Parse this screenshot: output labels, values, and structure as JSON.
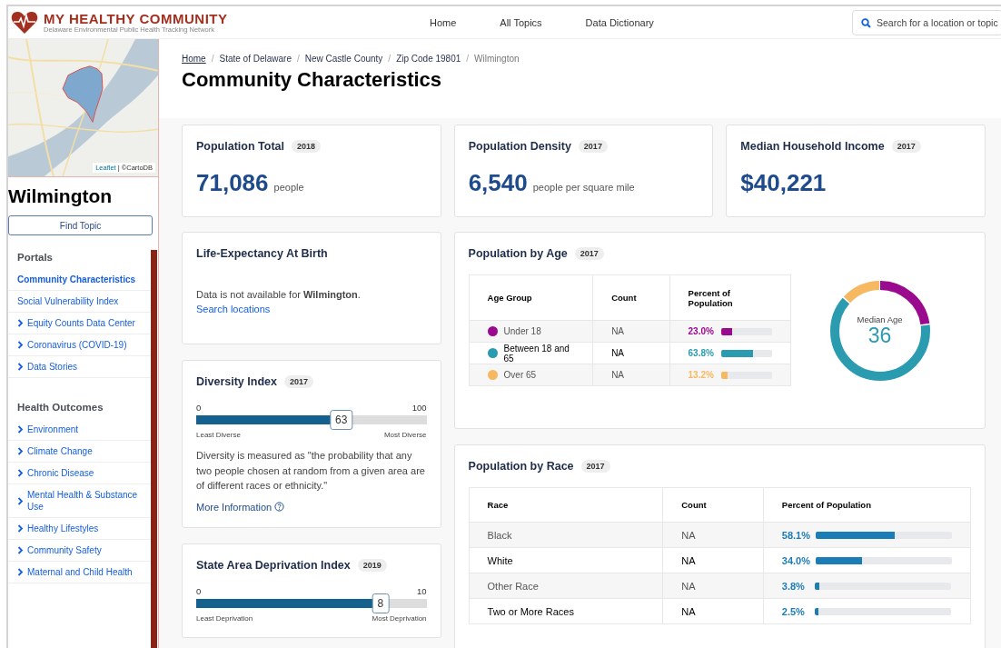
{
  "header": {
    "logo_title": "MY HEALTHY COMMUNITY",
    "logo_subtitle": "Delaware Environmental Public Health Tracking Network",
    "nav": [
      {
        "label": "Home"
      },
      {
        "label": "All Topics"
      },
      {
        "label": "Data Dictionary"
      }
    ],
    "search": {
      "placeholder": "Search for a location or topic"
    }
  },
  "sidebar": {
    "map": {
      "kind": "picture",
      "attribution_link": "Leaflet",
      "attribution": "| ©CartoDB"
    },
    "title": "Wilmington",
    "find_button": "Find Topic",
    "sections": [
      {
        "heading": "Portals",
        "items": [
          {
            "label": "Community Characteristics",
            "selected": true,
            "expandable": false
          },
          {
            "label": "Social Vulnerability Index",
            "selected": false,
            "expandable": false
          },
          {
            "label": "Equity Counts Data Center",
            "selected": false,
            "expandable": true
          },
          {
            "label": "Coronavirus (COVID-19)",
            "selected": false,
            "expandable": true
          },
          {
            "label": "Data Stories",
            "selected": false,
            "expandable": true
          }
        ]
      },
      {
        "heading": "Health Outcomes",
        "items": [
          {
            "label": "Environment",
            "selected": false,
            "expandable": true
          },
          {
            "label": "Climate Change",
            "selected": false,
            "expandable": true
          },
          {
            "label": "Chronic Disease",
            "selected": false,
            "expandable": true
          },
          {
            "label": "Mental Health & Substance Use",
            "selected": false,
            "expandable": true
          },
          {
            "label": "Healthy Lifestyles",
            "selected": false,
            "expandable": true
          },
          {
            "label": "Community Safety",
            "selected": false,
            "expandable": true
          },
          {
            "label": "Maternal and Child Health",
            "selected": false,
            "expandable": true
          }
        ]
      }
    ]
  },
  "breadcrumb_separator": "/",
  "breadcrumb": [
    {
      "label": "Home",
      "kind": "link"
    },
    {
      "label": "State of Delaware",
      "kind": "crumb"
    },
    {
      "label": "New Castle County",
      "kind": "crumb"
    },
    {
      "label": "Zip Code 19801",
      "kind": "crumb"
    },
    {
      "label": "Wilmington",
      "kind": "current"
    }
  ],
  "page_title": "Community Characteristics",
  "stats": [
    {
      "title": "Population Total",
      "year": "2018",
      "value": "71,086",
      "unit": "people"
    },
    {
      "title": "Population Density",
      "year": "2017",
      "value": "6,540",
      "unit": "people per square mile"
    },
    {
      "title": "Median Household Income",
      "year": "2017",
      "value": "$40,221"
    }
  ],
  "life_expectancy": {
    "title": "Life-Expectancy At Birth",
    "message": "Data is not available for **Wilmington**.",
    "link": "Search locations"
  },
  "indices": [
    {
      "title": "Diversity Index",
      "year": "2017",
      "min": "0",
      "max": "100",
      "level": 0.63,
      "value": "63",
      "min_label": "Least Diverse",
      "max_label": "Most Diverse",
      "description": "Diversity is measured as \"the probability that any two people chosen at random from a given area are of different races or ethnicity.\"",
      "more_link": "More Information"
    },
    {
      "title": "State Area Deprivation Index",
      "year": "2019",
      "min": "0",
      "max": "10",
      "level": 0.8,
      "value": "8",
      "min_label": "Least Deprivation",
      "max_label": "Most Deprivation"
    }
  ],
  "age": {
    "title": "Population by Age",
    "year": "2017",
    "columns": [
      "Age Group",
      "Count",
      "Percent of Population"
    ],
    "rows": [
      {
        "group": "Under 18",
        "count": "NA",
        "percent": "23.0%",
        "level": 0.23,
        "color": "#990a8e"
      },
      {
        "group": "Between 18 and 65",
        "count": "NA",
        "percent": "63.8%",
        "level": 0.638,
        "color": "#2b9cb0"
      },
      {
        "group": "Over 65",
        "count": "NA",
        "percent": "13.2%",
        "level": 0.132,
        "color": "#f7b862"
      }
    ],
    "median_label": "Median Age",
    "median": "36"
  },
  "race": {
    "title": "Population by Race",
    "year": "2017",
    "columns": [
      "Race",
      "Count",
      "Percent of Population"
    ],
    "rows": [
      {
        "race": "Black",
        "count": "NA",
        "percent": "58.1%",
        "level": 0.581
      },
      {
        "race": "White",
        "count": "NA",
        "percent": "34.0%",
        "level": 0.34
      },
      {
        "race": "Other Race",
        "count": "NA",
        "percent": "3.8%",
        "level": 0.038
      },
      {
        "race": "Two or More Races",
        "count": "NA",
        "percent": "2.5%",
        "level": 0.025
      }
    ]
  }
}
